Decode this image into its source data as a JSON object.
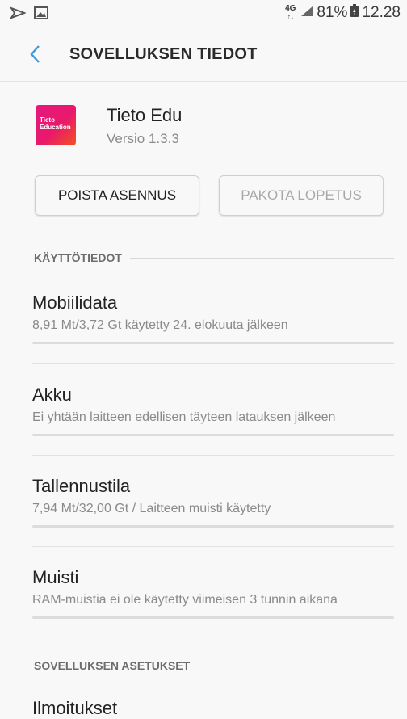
{
  "status": {
    "network_type": "4G",
    "battery_percent": "81%",
    "time": "12.28"
  },
  "header": {
    "title": "SOVELLUKSEN TIEDOT"
  },
  "app": {
    "icon_text_line1": "Tieto",
    "icon_text_line2": "Education",
    "name": "Tieto Edu",
    "version": "Versio 1.3.3"
  },
  "buttons": {
    "uninstall": "POISTA ASENNUS",
    "force_stop": "PAKOTA LOPETUS"
  },
  "usage_section": {
    "label": "KÄYTTÖTIEDOT",
    "items": [
      {
        "title": "Mobiilidata",
        "subtitle": "8,91 Mt/3,72 Gt käytetty 24. elokuuta jälkeen"
      },
      {
        "title": "Akku",
        "subtitle": "Ei yhtään laitteen edellisen täyteen latauksen jälkeen"
      },
      {
        "title": "Tallennustila",
        "subtitle": "7,94 Mt/32,00 Gt / Laitteen muisti käytetty"
      },
      {
        "title": "Muisti",
        "subtitle": "RAM-muistia ei ole käytetty viimeisen 3 tunnin aikana"
      }
    ]
  },
  "settings_section": {
    "label": "SOVELLUKSEN ASETUKSET",
    "items": [
      {
        "title": "Ilmoitukset"
      }
    ]
  },
  "colors": {
    "back_arrow": "#3f9ad9",
    "app_icon_gradient_start": "#e5197f",
    "app_icon_gradient_end": "#f4511e"
  }
}
